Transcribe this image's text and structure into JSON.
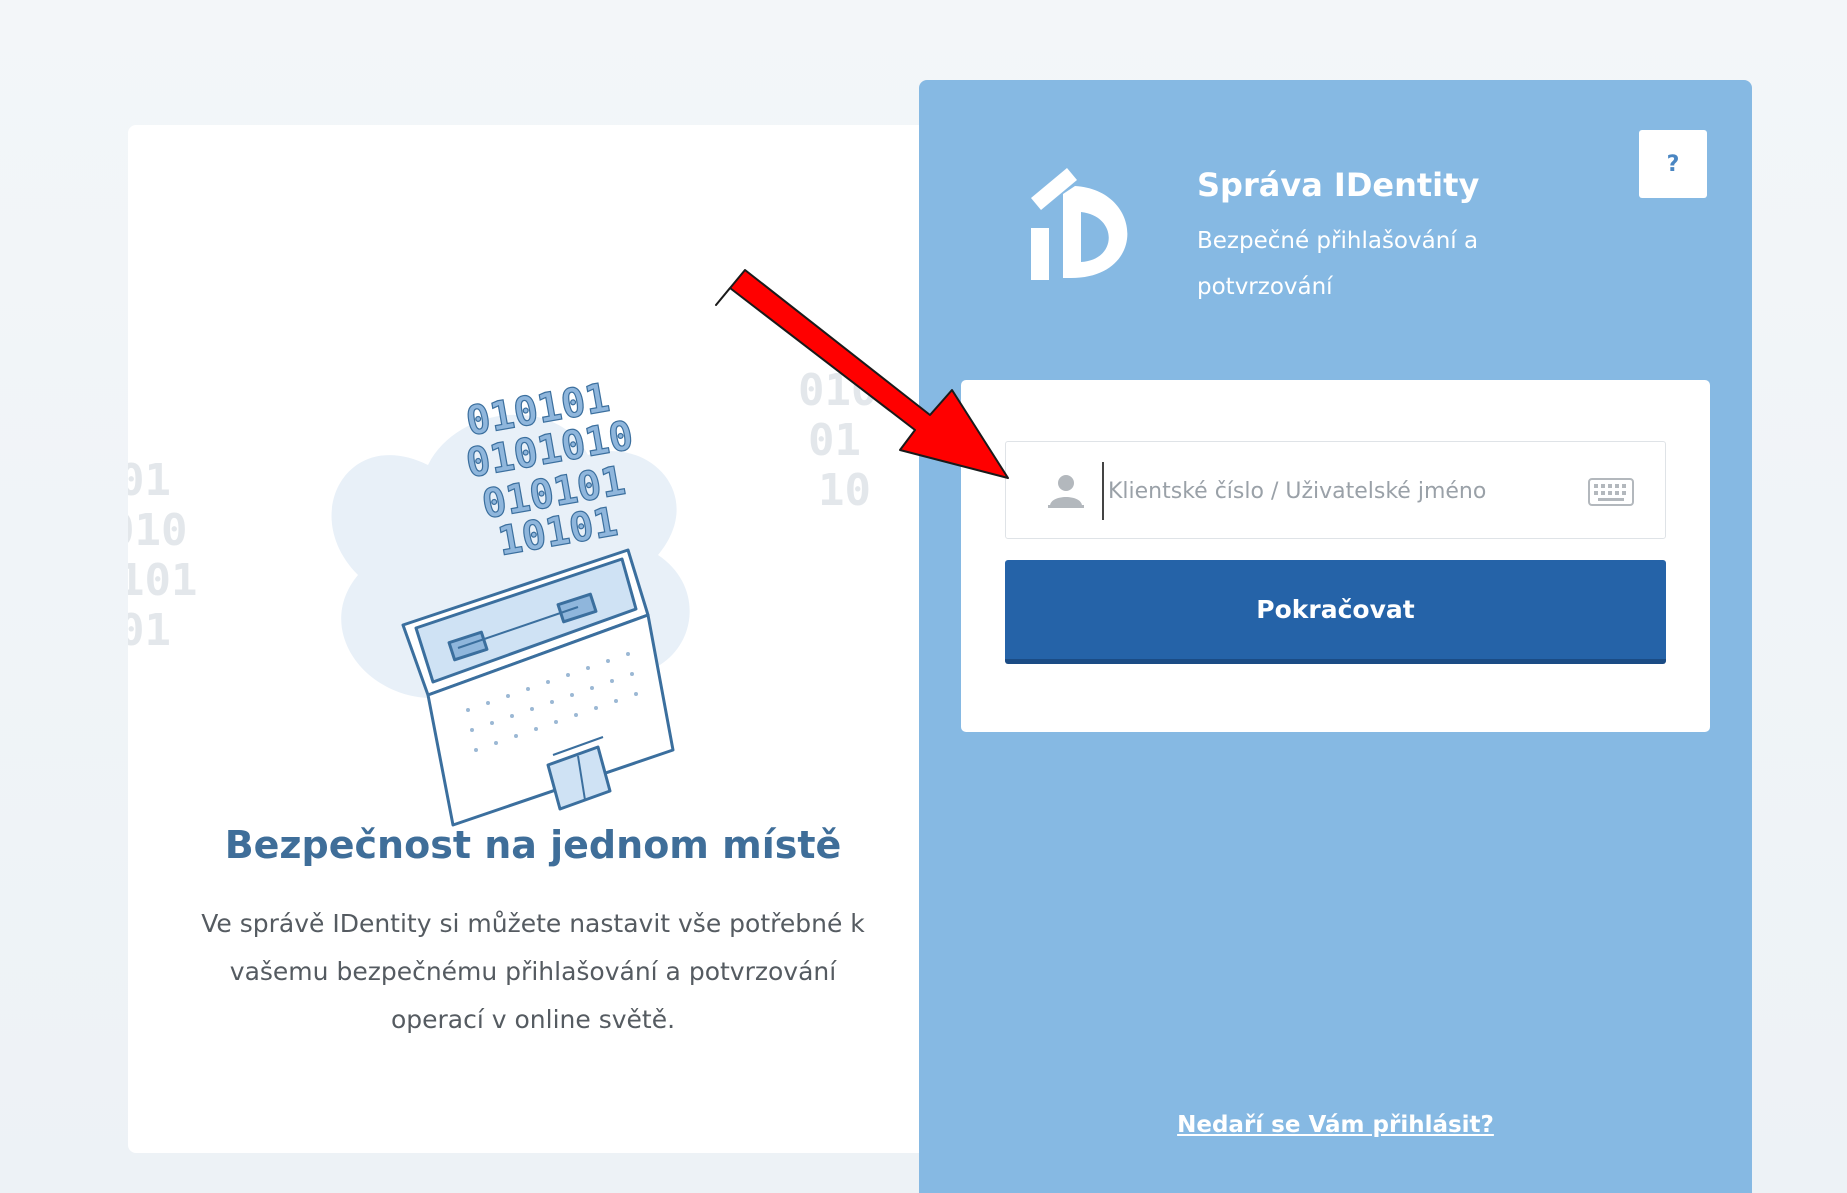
{
  "left": {
    "title": "Bezpečnost na jednom místě",
    "text": "Ve správě IDentity si můžete nastavit vše potřebné k vašemu bezpečnému přihlašování a potvrzování operací v online světě.",
    "binary_lines": [
      "010101",
      "0101010",
      "010101",
      "10101"
    ]
  },
  "header": {
    "logo_text": "iD",
    "title": "Správa IDentity",
    "subtitle": "Bezpečné přihlašování a potvrzování",
    "help_label": "?"
  },
  "form": {
    "username_placeholder": "Klientské číslo / Uživatelské jméno",
    "username_value": "",
    "submit_label": "Pokračovat"
  },
  "footer": {
    "help_link": "Nedaří se Vám přihlásit?"
  },
  "icons": {
    "user": "user-icon",
    "keyboard": "keyboard-icon",
    "logo": "identity-logo-icon",
    "arrow": "arrow-annotation"
  },
  "colors": {
    "panel": "#86b9e3",
    "button": "#2563a8",
    "title": "#3f6e99",
    "arrow": "#ff0000"
  }
}
